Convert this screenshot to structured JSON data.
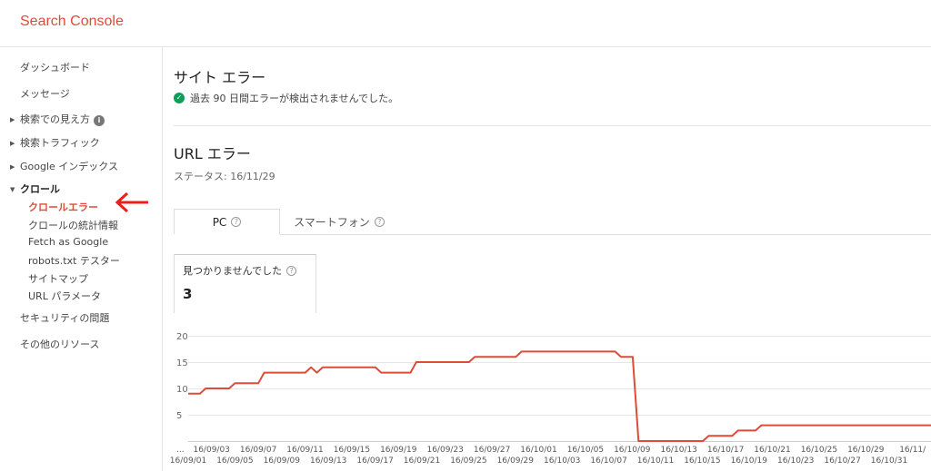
{
  "app": {
    "title": "Search Console"
  },
  "sidebar": {
    "items": [
      {
        "label": "ダッシュボード"
      },
      {
        "label": "メッセージ"
      },
      {
        "label": "検索での見え方",
        "info": "i"
      },
      {
        "label": "検索トラフィック"
      },
      {
        "label": "Google インデックス"
      },
      {
        "label": "クロール"
      },
      {
        "label": "セキュリティの問題"
      },
      {
        "label": "その他のリソース"
      }
    ],
    "crawl_sub": [
      {
        "label": "クロールエラー"
      },
      {
        "label": "クロールの統計情報"
      },
      {
        "label": "Fetch as Google"
      },
      {
        "label": "robots.txt テスター"
      },
      {
        "label": "サイトマップ"
      },
      {
        "label": "URL パラメータ"
      }
    ],
    "arrow_color": "#e8201b"
  },
  "site_errors": {
    "title": "サイト エラー",
    "ok_message": "過去 90 日間エラーが検出されませんでした。"
  },
  "url_errors": {
    "title": "URL エラー",
    "status": "ステータス: 16/11/29",
    "tabs": [
      {
        "label": "PC"
      },
      {
        "label": "スマートフォン"
      }
    ],
    "help_glyph": "?",
    "metric": {
      "label": "見つかりませんでした",
      "value": "3"
    }
  },
  "chart_data": {
    "type": "line",
    "color": "#dd4b39",
    "ylim": [
      0,
      20
    ],
    "yticks": [
      "20",
      "15",
      "10",
      "5"
    ],
    "first_label": "...",
    "x_labels_top": [
      "16/09/03",
      "16/09/07",
      "16/09/11",
      "16/09/15",
      "16/09/19",
      "16/09/23",
      "16/09/27",
      "16/10/01",
      "16/10/05",
      "16/10/09",
      "16/10/13",
      "16/10/17",
      "16/10/21",
      "16/10/25",
      "16/10/29",
      "16/11/"
    ],
    "x_labels_bottom": [
      "16/09/01",
      "16/09/05",
      "16/09/09",
      "16/09/13",
      "16/09/17",
      "16/09/21",
      "16/09/25",
      "16/09/29",
      "16/10/03",
      "16/10/07",
      "16/10/11",
      "16/10/15",
      "16/10/19",
      "16/10/23",
      "16/10/27",
      "16/10/31"
    ],
    "values": [
      9,
      9,
      9,
      10,
      10,
      10,
      10,
      10,
      11,
      11,
      11,
      11,
      11,
      13,
      13,
      13,
      13,
      13,
      13,
      13,
      13,
      14,
      13,
      14,
      14,
      14,
      14,
      14,
      14,
      14,
      14,
      14,
      14,
      13,
      13,
      13,
      13,
      13,
      13,
      15,
      15,
      15,
      15,
      15,
      15,
      15,
      15,
      15,
      15,
      16,
      16,
      16,
      16,
      16,
      16,
      16,
      16,
      17,
      17,
      17,
      17,
      17,
      17,
      17,
      17,
      17,
      17,
      17,
      17,
      17,
      17,
      17,
      17,
      17,
      16,
      16,
      16,
      0,
      0,
      0,
      0,
      0,
      0,
      0,
      0,
      0,
      0,
      0,
      0,
      1,
      1,
      1,
      1,
      1,
      2,
      2,
      2,
      2,
      3,
      3,
      3,
      3,
      3,
      3,
      3,
      3,
      3,
      3,
      3,
      3,
      3,
      3,
      3,
      3,
      3,
      3,
      3,
      3,
      3,
      3,
      3,
      3,
      3,
      3,
      3,
      3,
      3,
      3
    ]
  }
}
